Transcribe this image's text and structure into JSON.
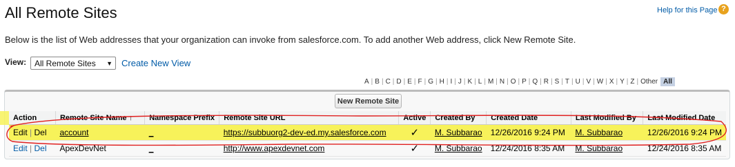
{
  "page": {
    "title": "All Remote Sites",
    "help_label": "Help for this Page",
    "help_icon": "help-icon",
    "description": "Below is the list of Web addresses that your organization can invoke from salesforce.com. To add another Web address, click New Remote Site.",
    "view_label": "View:",
    "view_value": "All Remote Sites",
    "create_view": "Create New View",
    "new_button": "New Remote Site",
    "alpha": [
      "A",
      "B",
      "C",
      "D",
      "E",
      "F",
      "G",
      "H",
      "I",
      "J",
      "K",
      "L",
      "M",
      "N",
      "O",
      "P",
      "Q",
      "R",
      "S",
      "T",
      "U",
      "V",
      "W",
      "X",
      "Y",
      "Z",
      "Other"
    ],
    "alpha_selected": "All"
  },
  "table": {
    "headers": [
      "Action",
      "Remote Site Name ↑",
      "Namespace Prefix",
      "Remote Site URL",
      "Active",
      "Created By",
      "Created Date",
      "Last Modified By",
      "Last Modified Date"
    ],
    "rows": [
      {
        "edit": "Edit",
        "sep": "|",
        "del": "Del",
        "name": "account",
        "ns": "_",
        "url": "https://subbuorg2-dev-ed.my.salesforce.com",
        "active": "✓",
        "created_by": "M. Subbarao",
        "created_date": "12/26/2016 9:24 PM",
        "modified_by": "M. Subbarao",
        "modified_date": "12/26/2016 9:24 PM"
      },
      {
        "edit": "Edit",
        "sep": "|",
        "del": "Del",
        "name": "ApexDevNet",
        "ns": "_",
        "url": "http://www.apexdevnet.com",
        "active": "✓",
        "created_by": "M. Subbarao",
        "created_date": "12/24/2016 8:35 AM",
        "modified_by": "M. Subbarao",
        "modified_date": "12/24/2016 8:35 AM"
      }
    ]
  },
  "colors": {
    "highlight": "#f7f25a",
    "annotation": "#e02020",
    "link": "#015ba7"
  }
}
